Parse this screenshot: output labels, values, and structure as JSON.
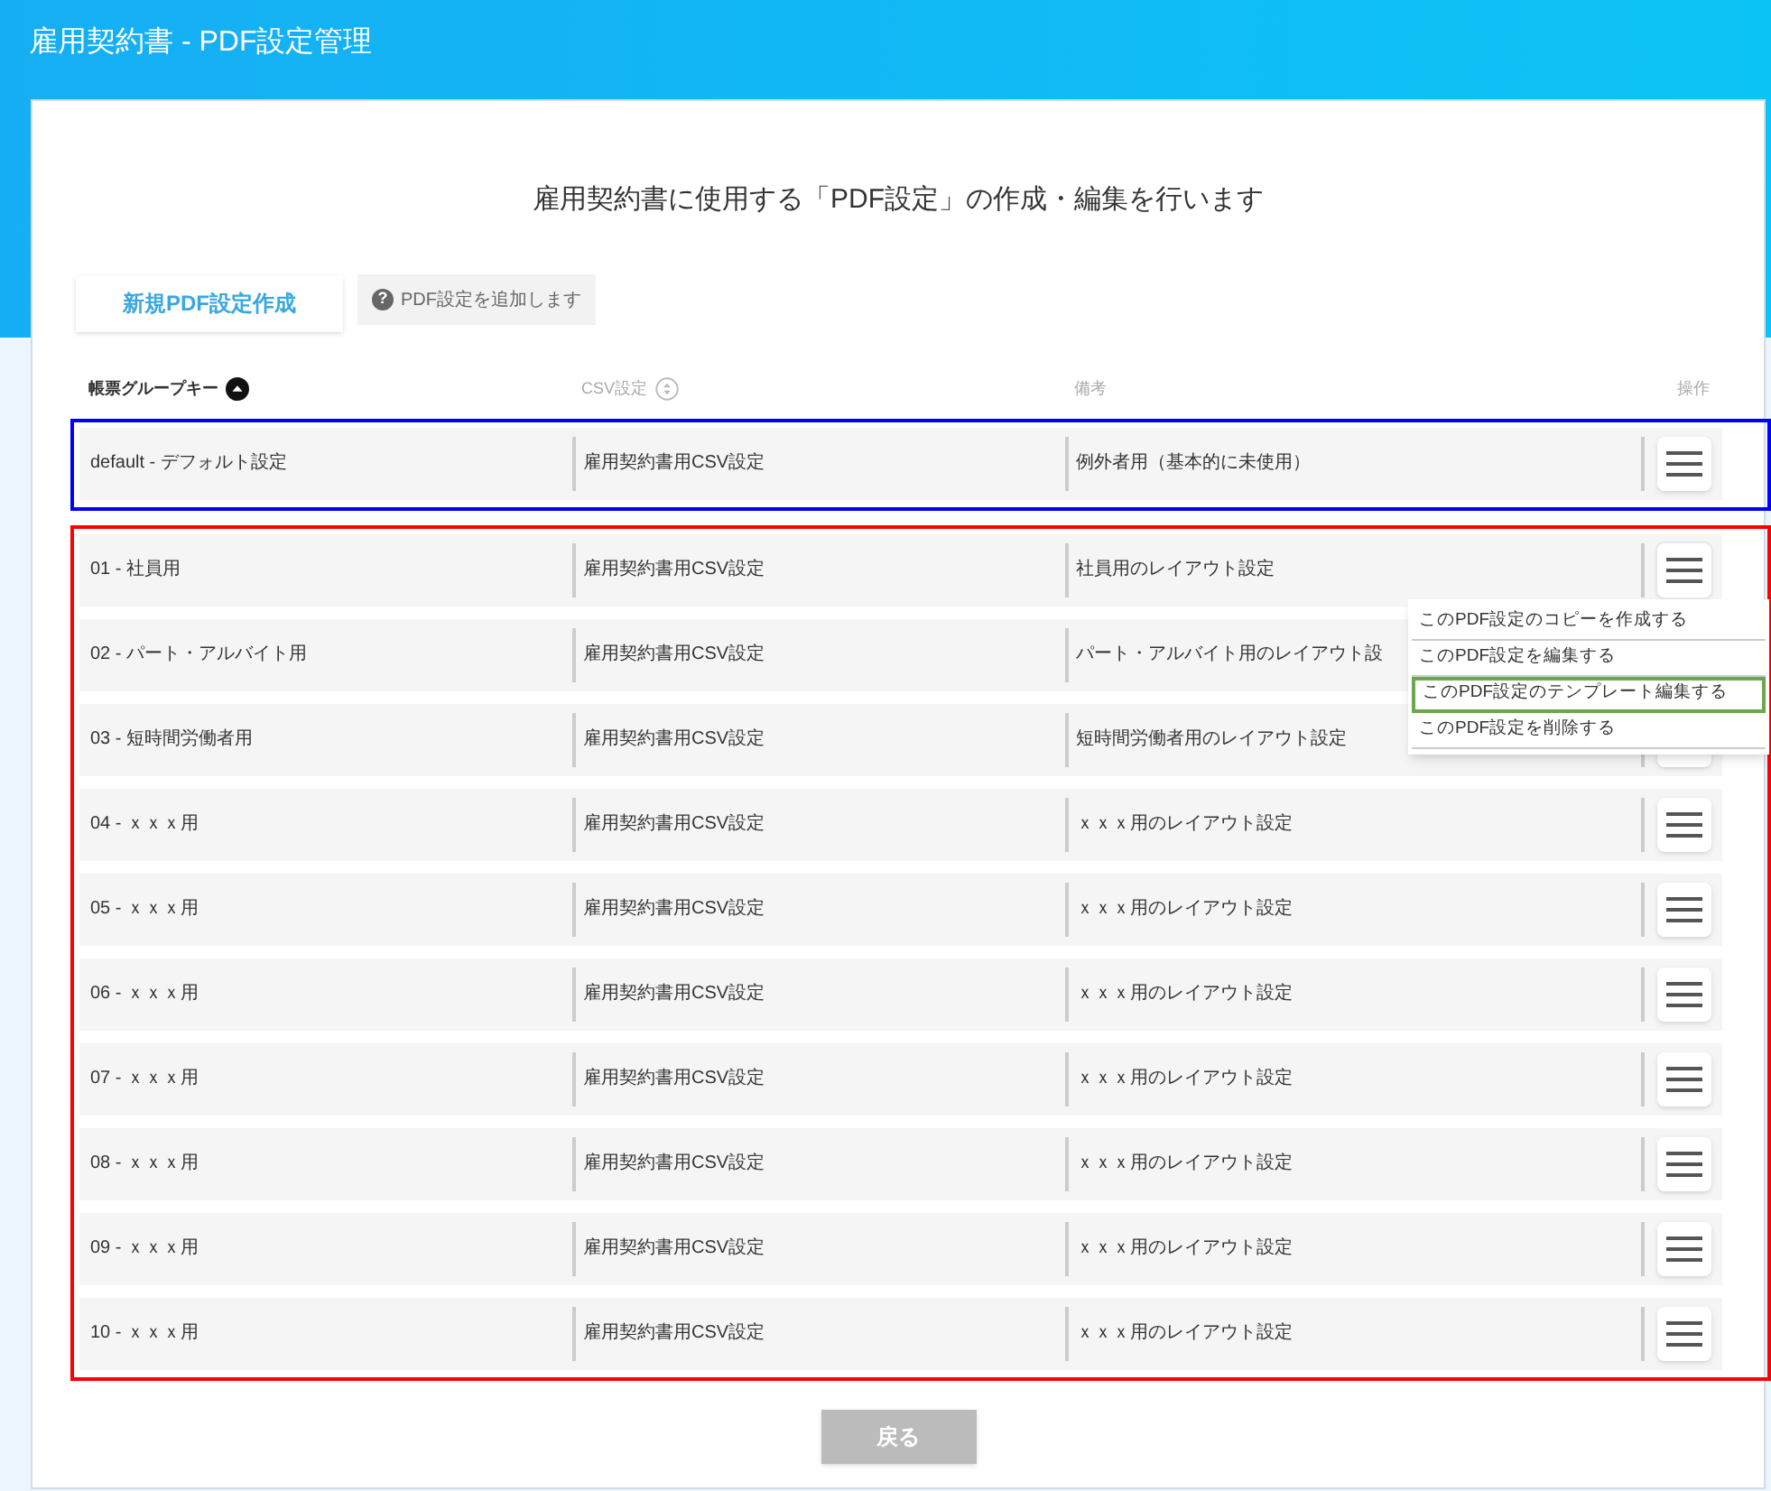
{
  "window": {
    "title": "雇用契約書 - PDF設定管理"
  },
  "heading": "雇用契約書に使用する「PDF設定」の作成・編集を行います",
  "new_button": "新規PDF設定作成",
  "help": {
    "icon": "?",
    "text": "PDF設定を追加します"
  },
  "table": {
    "columns": [
      {
        "label": "帳票グループキー",
        "sortable": true,
        "sorted": true
      },
      {
        "label": "CSV設定",
        "sortable": true,
        "sorted": false
      },
      {
        "label": "備考",
        "sortable": false
      },
      {
        "label": "操作",
        "sortable": false
      }
    ],
    "groups": [
      {
        "color": "#0000ff",
        "rows": [
          {
            "key": "default - デフォルト設定",
            "csv": "雇用契約書用CSV設定",
            "note": "例外者用（基本的に未使用）"
          }
        ]
      },
      {
        "color": "#ff0000",
        "rows": [
          {
            "key": "01 - 社員用",
            "csv": "雇用契約書用CSV設定",
            "note": "社員用のレイアウト設定",
            "menu_open": true
          },
          {
            "key": "02 - パート・アルバイト用",
            "csv": "雇用契約書用CSV設定",
            "note": "パート・アルバイト用のレイアウト設",
            "menu_button_visible": false
          },
          {
            "key": "03 - 短時間労働者用",
            "csv": "雇用契約書用CSV設定",
            "note": "短時間労働者用のレイアウト設定"
          },
          {
            "key": "04 - ｘｘｘ用",
            "csv": "雇用契約書用CSV設定",
            "note": "ｘｘｘ用のレイアウト設定"
          },
          {
            "key": "05 - ｘｘｘ用",
            "csv": "雇用契約書用CSV設定",
            "note": "ｘｘｘ用のレイアウト設定"
          },
          {
            "key": "06 - ｘｘｘ用",
            "csv": "雇用契約書用CSV設定",
            "note": "ｘｘｘ用のレイアウト設定"
          },
          {
            "key": "07 - ｘｘｘ用",
            "csv": "雇用契約書用CSV設定",
            "note": "ｘｘｘ用のレイアウト設定"
          },
          {
            "key": "08 - ｘｘｘ用",
            "csv": "雇用契約書用CSV設定",
            "note": "ｘｘｘ用のレイアウト設定"
          },
          {
            "key": "09 - ｘｘｘ用",
            "csv": "雇用契約書用CSV設定",
            "note": "ｘｘｘ用のレイアウト設定"
          },
          {
            "key": "10 - ｘｘｘ用",
            "csv": "雇用契約書用CSV設定",
            "note": "ｘｘｘ用のレイアウト設定"
          }
        ]
      }
    ]
  },
  "menu": {
    "items": [
      {
        "label": "このPDF設定のコピーを作成する",
        "highlighted": false
      },
      {
        "label": "このPDF設定を編集する",
        "highlighted": false
      },
      {
        "label": "このPDF設定のテンプレート編集する",
        "highlighted": true
      },
      {
        "label": "このPDF設定を削除する",
        "highlighted": false
      }
    ]
  },
  "back_button": {
    "label": "戻る",
    "disabled": true
  }
}
